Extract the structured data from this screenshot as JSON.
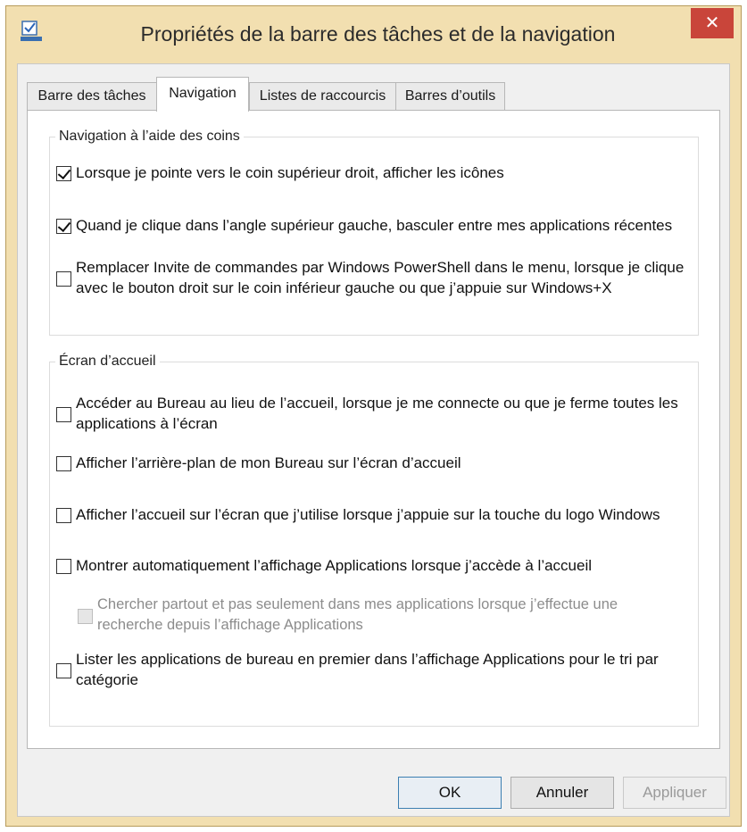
{
  "window": {
    "title": "Propriétés de la barre des tâches et de la navigation",
    "close_label": "✕"
  },
  "tabs": [
    {
      "label": "Barre des tâches",
      "active": false
    },
    {
      "label": "Navigation",
      "active": true
    },
    {
      "label": "Listes de raccourcis",
      "active": false
    },
    {
      "label": "Barres d’outils",
      "active": false
    }
  ],
  "corner_group": {
    "legend": "Navigation à l’aide des coins",
    "options": [
      {
        "label": "Lorsque je pointe vers le coin supérieur droit, afficher les icônes",
        "checked": true
      },
      {
        "label": "Quand je clique dans l’angle supérieur gauche, basculer entre mes applications récentes",
        "checked": true
      },
      {
        "label_line1": "Remplacer Invite de commandes par Windows PowerShell dans le menu, lorsque je clique",
        "label_line2": "avec le bouton droit sur le coin inférieur gauche ou que j’appuie sur Windows+X",
        "checked": false
      }
    ]
  },
  "start_group": {
    "legend": "Écran d’accueil",
    "options": [
      {
        "label_line1": "Accéder au Bureau au lieu de l’accueil, lorsque je me connecte ou que je ferme toutes les",
        "label_line2": "applications à l’écran",
        "checked": false
      },
      {
        "label": "Afficher l’arrière-plan de mon Bureau sur l’écran d’accueil",
        "checked": false
      },
      {
        "label": "Afficher l’accueil sur l’écran que j’utilise lorsque j’appuie sur la touche du logo Windows",
        "checked": false
      },
      {
        "label": "Montrer automatiquement l’affichage Applications lorsque j’accède à l’accueil",
        "checked": false
      },
      {
        "label_line1": "Chercher partout et pas seulement dans mes applications lorsque j’effectue une",
        "label_line2": "recherche depuis l’affichage Applications",
        "checked": false,
        "disabled": true
      },
      {
        "label_line1": "Lister les applications de bureau en premier dans l’affichage Applications pour le tri par",
        "label_line2": "catégorie",
        "checked": false
      }
    ]
  },
  "buttons": {
    "ok": "OK",
    "cancel": "Annuler",
    "apply": "Appliquer"
  },
  "colors": {
    "frame": "#f2dfb0",
    "close": "#c9453a",
    "accent": "#3c7fb1"
  }
}
